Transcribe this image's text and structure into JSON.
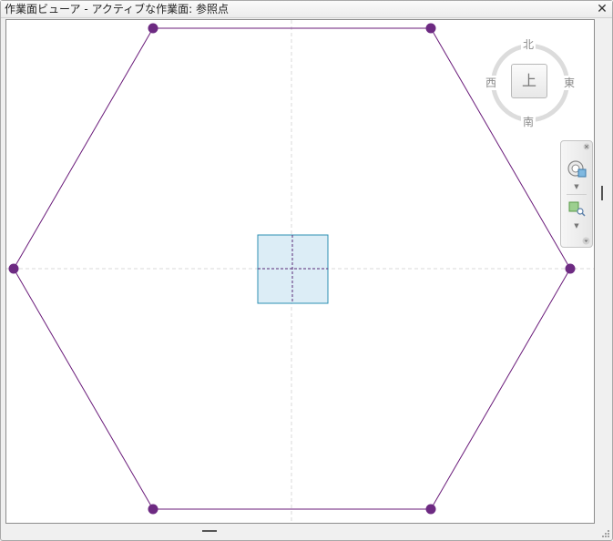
{
  "window": {
    "title": "作業面ビューア - アクティブな作業面: 参照点",
    "close_icon": "close-icon"
  },
  "viewcube": {
    "face_label": "上",
    "north": "北",
    "south": "南",
    "east": "東",
    "west": "西"
  },
  "navigation_bar": {
    "items": [
      {
        "name": "close-icon"
      },
      {
        "name": "steering-wheel-icon"
      },
      {
        "name": "dropdown-arrow-icon"
      },
      {
        "name": "zoom-region-icon"
      },
      {
        "name": "dropdown-arrow-icon"
      },
      {
        "name": "nav-menu-icon"
      }
    ]
  },
  "colors": {
    "hexagon_line": "#6a1b7a",
    "vertex_point": "#6d2a82",
    "reference_square_fill": "#dcedf6",
    "reference_square_border": "#2b8fb3",
    "guide_line": "#d6d6d6"
  }
}
